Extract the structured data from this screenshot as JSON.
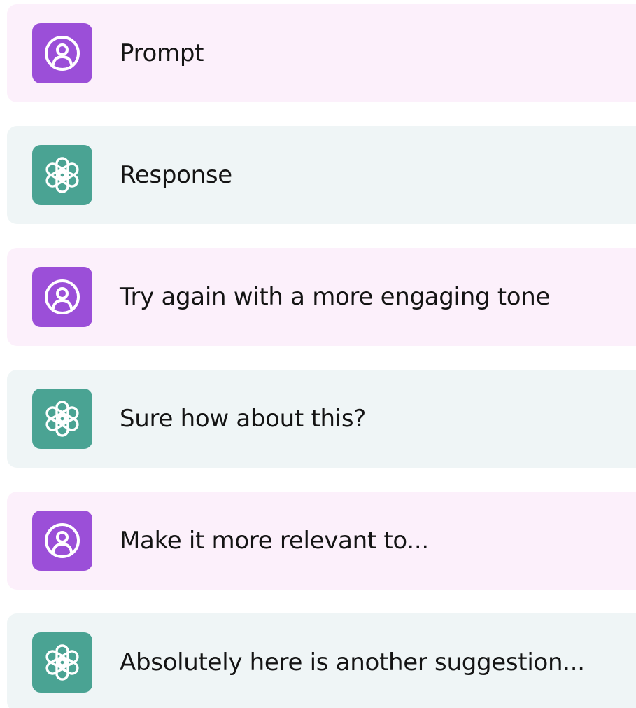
{
  "conversation": {
    "messages": [
      {
        "role": "user",
        "icon": "user-icon",
        "text": "Prompt"
      },
      {
        "role": "assistant",
        "icon": "openai-logo-icon",
        "text": "Response"
      },
      {
        "role": "user",
        "icon": "user-icon",
        "text": "Try again with a more engaging tone"
      },
      {
        "role": "assistant",
        "icon": "openai-logo-icon",
        "text": "Sure how about this?"
      },
      {
        "role": "user",
        "icon": "user-icon",
        "text": "Make it more relevant to..."
      },
      {
        "role": "assistant",
        "icon": "openai-logo-icon",
        "text": "Absolutely here is another suggestion..."
      }
    ]
  },
  "colors": {
    "user_row_bg": "#fcf0fb",
    "assistant_row_bg": "#eff5f6",
    "user_avatar": "#9b4fd8",
    "assistant_avatar": "#4aa393",
    "text": "#141414"
  }
}
